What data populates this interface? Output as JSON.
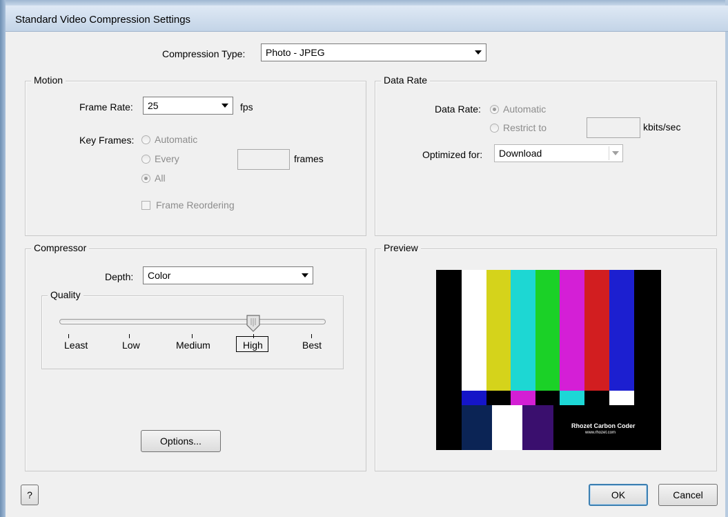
{
  "window": {
    "title": "Standard Video Compression Settings"
  },
  "compression": {
    "label": "Compression Type:",
    "value": "Photo - JPEG"
  },
  "motion": {
    "title": "Motion",
    "frame_rate_label": "Frame Rate:",
    "frame_rate_value": "25",
    "fps_unit": "fps",
    "key_frames_label": "Key Frames:",
    "key_frames_options": [
      "Automatic",
      "Every",
      "All"
    ],
    "key_frames_selected": "All",
    "frames_unit": "frames",
    "frame_reordering_label": "Frame Reordering",
    "frame_reordering_checked": false
  },
  "data_rate": {
    "title": "Data Rate",
    "label": "Data Rate:",
    "options": [
      "Automatic",
      "Restrict to"
    ],
    "selected": "Automatic",
    "unit": "kbits/sec",
    "optimized_label": "Optimized for:",
    "optimized_value": "Download"
  },
  "compressor": {
    "title": "Compressor",
    "depth_label": "Depth:",
    "depth_value": "Color",
    "quality_title": "Quality",
    "quality_levels": [
      "Least",
      "Low",
      "Medium",
      "High",
      "Best"
    ],
    "quality_selected": "High",
    "options_button": "Options..."
  },
  "preview": {
    "title": "Preview",
    "caption_main": "Rhozet Carbon Coder",
    "caption_url": "www.rhozet.com",
    "colors": {
      "top_bars": [
        "#000000",
        "#ffffff",
        "#d5d31b",
        "#1dd7d3",
        "#1bd127",
        "#d41fd6",
        "#d21e20",
        "#1c1fd0",
        "#000000"
      ],
      "mid_bars": [
        "#000000",
        "#1515c8",
        "#000000",
        "#d31fd4",
        "#000000",
        "#1dd7d6",
        "#000000",
        "#ffffff",
        "#000000"
      ],
      "bottom_blocks": [
        "#0b2455",
        "#ffffff",
        "#3a0f6e",
        "#000000"
      ]
    }
  },
  "footer": {
    "help_button": "?",
    "ok_button": "OK",
    "cancel_button": "Cancel"
  }
}
